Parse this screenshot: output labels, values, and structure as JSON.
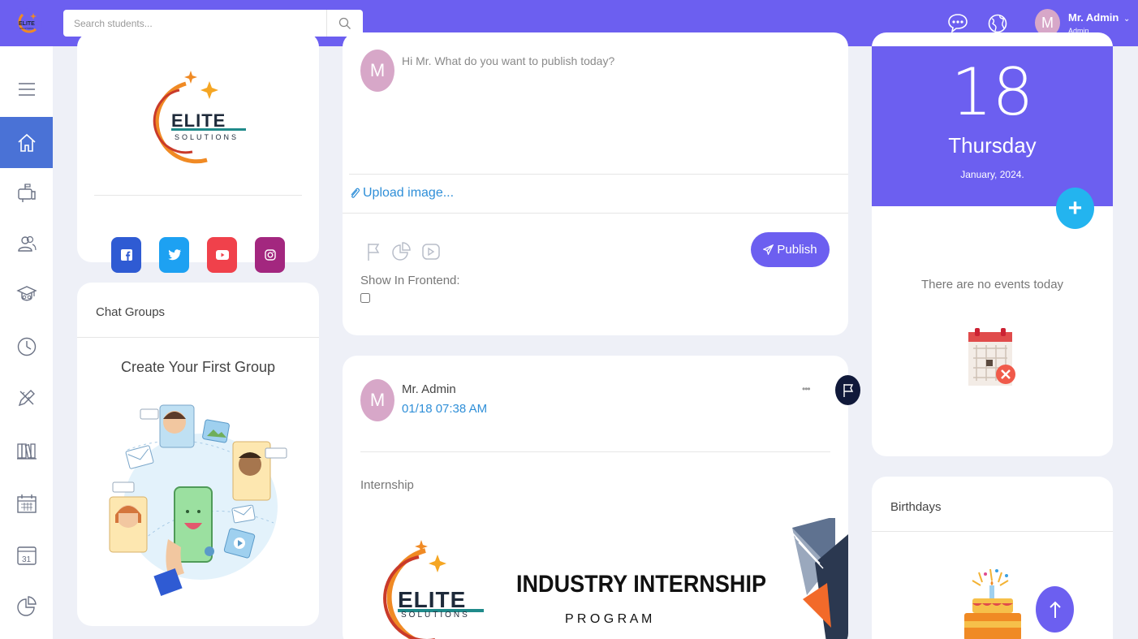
{
  "topbar": {
    "search_placeholder": "Search students...",
    "user": {
      "initial": "M",
      "name": "Mr. Admin",
      "role": "Admin"
    },
    "logo_text": "ELITE SOLUTIONS"
  },
  "sidebar": {
    "items": [
      "menu-icon",
      "home-icon",
      "mailbox-icon",
      "users-icon",
      "graduate-icon",
      "clock-icon",
      "pencil-ruler-icon",
      "books-icon",
      "calendar-grid-icon",
      "calendar-31-icon",
      "pie-chart-icon"
    ],
    "active": "home-icon",
    "calendar_day": "31"
  },
  "brand_card": {
    "logo_main": "ELITE",
    "logo_sub": "SOLUTIONS",
    "socials": [
      "facebook",
      "twitter",
      "youtube",
      "instagram"
    ]
  },
  "chat_groups": {
    "title": "Chat Groups",
    "empty_title": "Create Your First Group"
  },
  "composer": {
    "avatar_initial": "M",
    "placeholder": "Hi Mr. What do you want to publish today?",
    "upload_label": "Upload image...",
    "show_in_frontend": "Show In Frontend:",
    "publish_label": "Publish"
  },
  "post": {
    "avatar_initial": "M",
    "author": "Mr. Admin",
    "timestamp": "01/18 07:38 AM",
    "more": "•••",
    "body": "Internship",
    "banner_title": "INDUSTRY INTERNSHIP",
    "banner_sub": "P R O G R A M",
    "logo_main": "ELITE",
    "logo_sub": "SOLUTIONS"
  },
  "calendar": {
    "day": "18",
    "weekday": "Thursday",
    "month_year": "January, 2024.",
    "no_events": "There are no events today",
    "add": "+"
  },
  "birthdays": {
    "title": "Birthdays"
  },
  "colors": {
    "primary": "#6c5ff0",
    "accent": "#23b4ef",
    "active_nav": "#4a72d6",
    "link": "#2f8fd8"
  }
}
